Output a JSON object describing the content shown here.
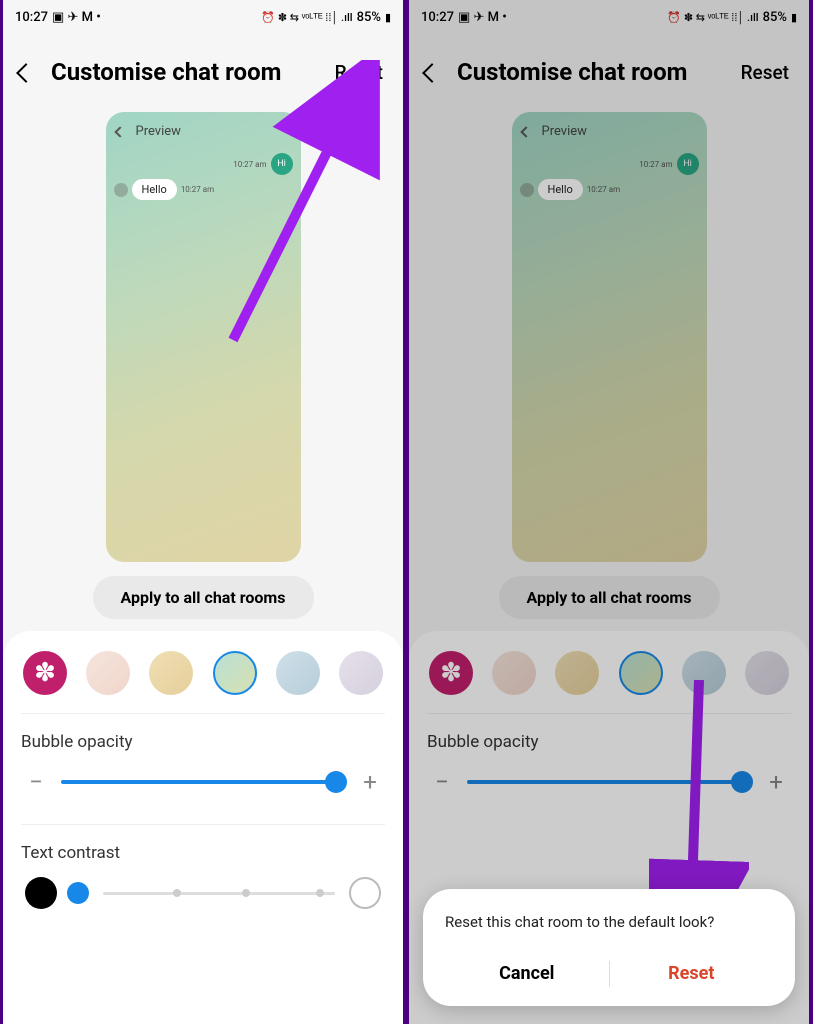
{
  "status": {
    "time": "10:27",
    "left_icons": "▣ ✈ M •",
    "right_icons": "⏰ ✽ ⇆ ᵛᵒᴸᵀᴱ ⁞⁞│ .ıll",
    "battery_text": "85%",
    "battery_icon": "▮"
  },
  "header": {
    "title": "Customise chat room",
    "reset": "Reset"
  },
  "preview": {
    "label": "Preview",
    "msg_hi": "Hi",
    "msg_hello": "Hello",
    "time_short": "10:27 am"
  },
  "apply_label": "Apply to all chat rooms",
  "opacity_label": "Bubble opacity",
  "contrast_label": "Text contrast",
  "dialog": {
    "text": "Reset this chat room to the default look?",
    "cancel": "Cancel",
    "reset": "Reset"
  },
  "glyphs": {
    "minus": "−",
    "plus": "+",
    "flower": "✽"
  }
}
